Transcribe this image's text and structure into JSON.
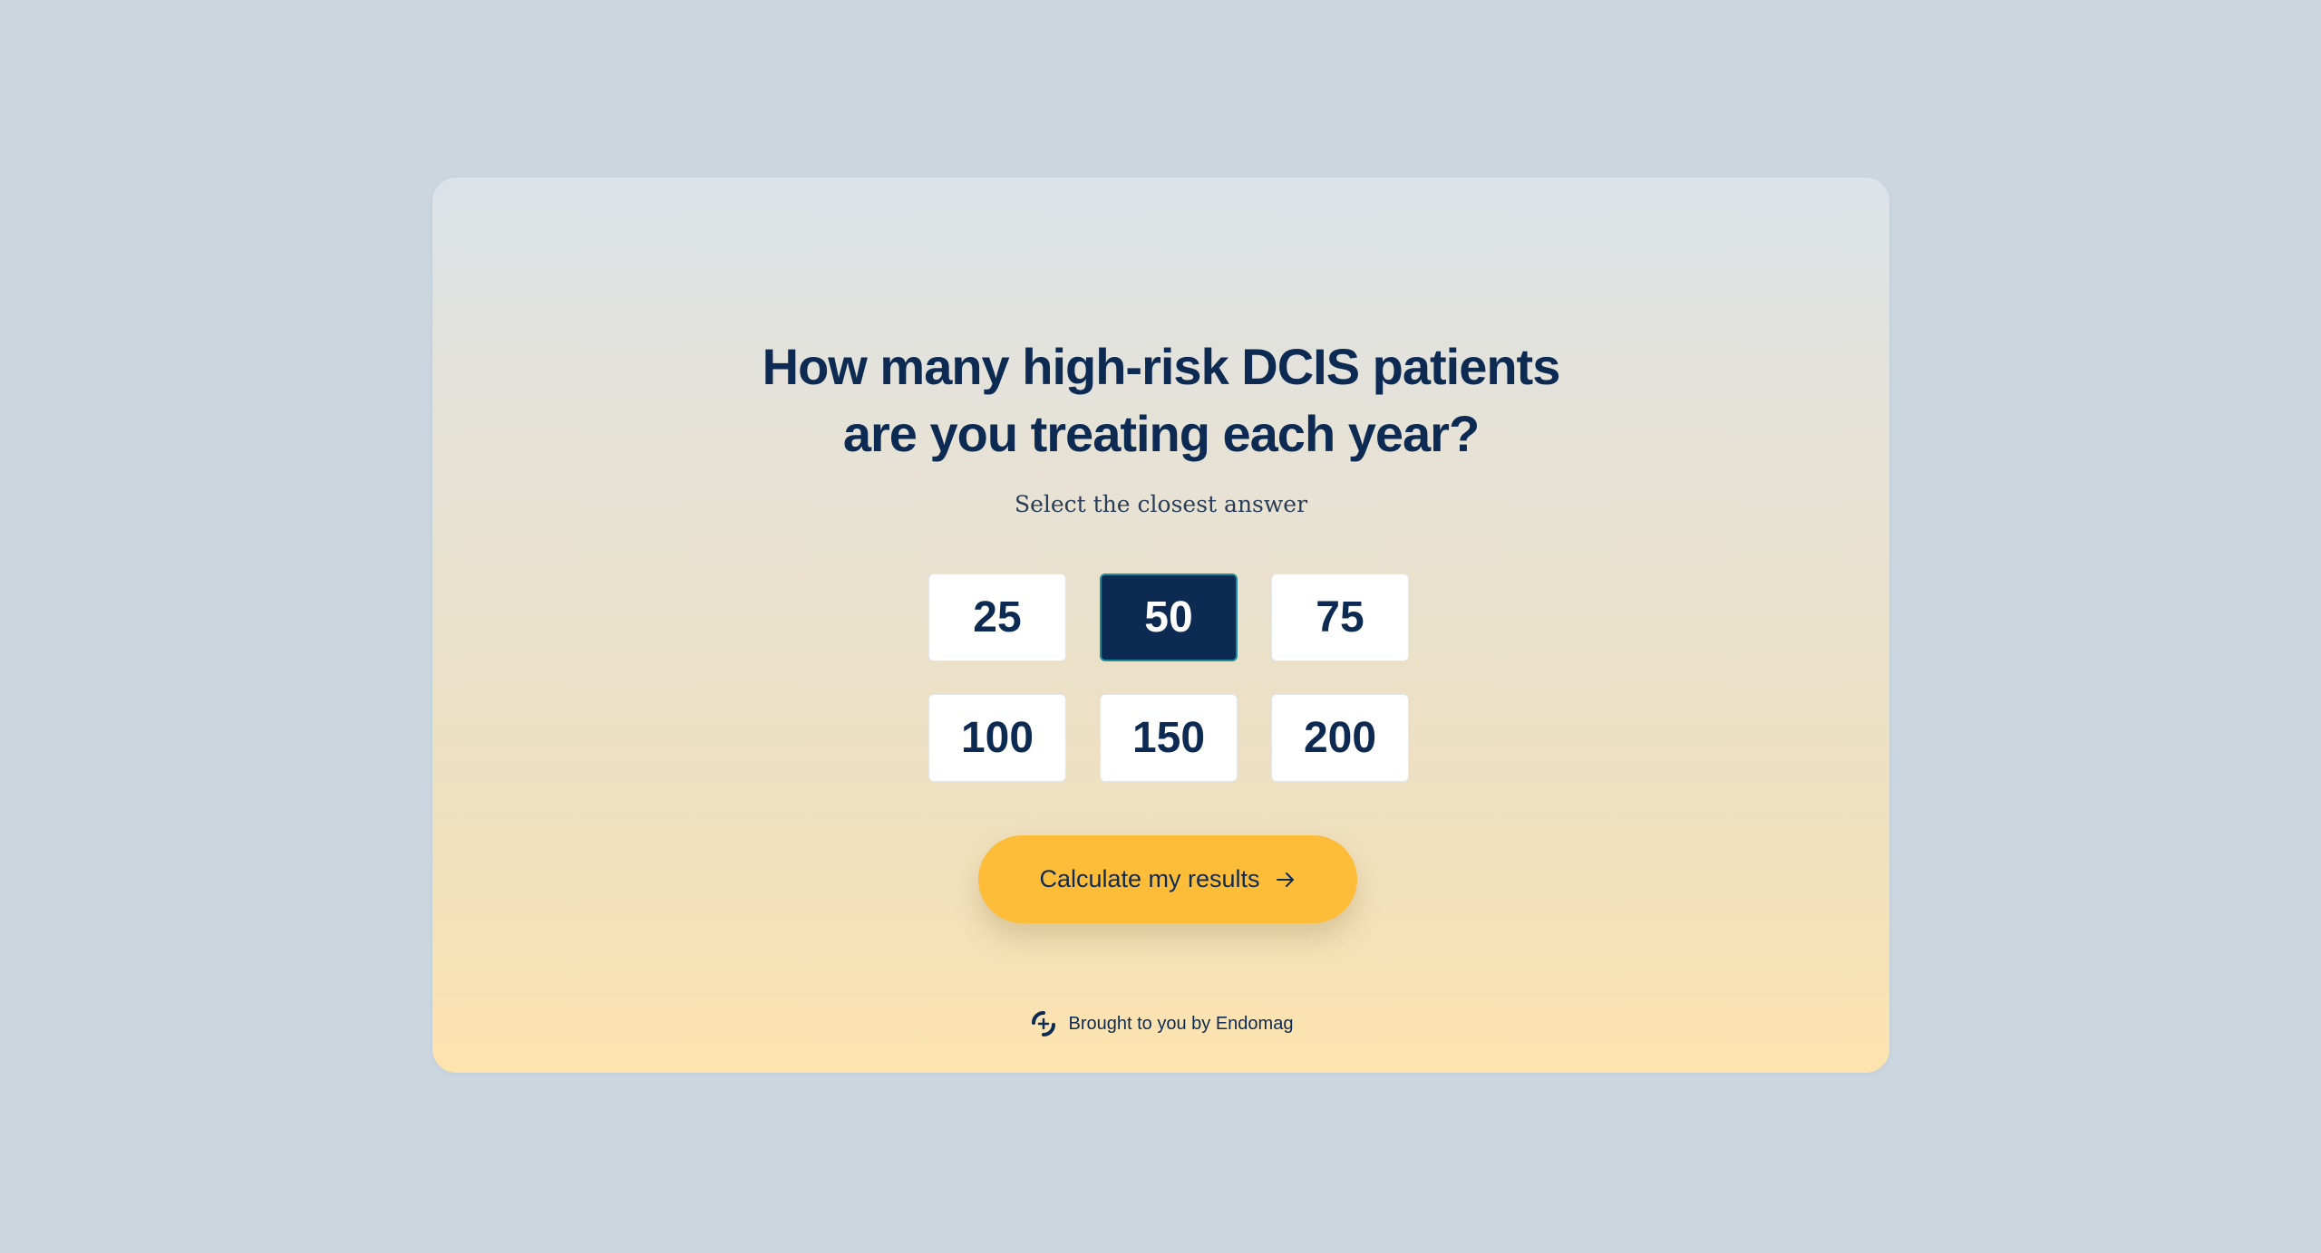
{
  "question": {
    "line1": "How many high-risk DCIS patients",
    "line2": "are you treating each year?"
  },
  "subtitle": "Select the closest answer",
  "options": [
    {
      "label": "25",
      "selected": false
    },
    {
      "label": "50",
      "selected": true
    },
    {
      "label": "75",
      "selected": false
    },
    {
      "label": "100",
      "selected": false
    },
    {
      "label": "150",
      "selected": false
    },
    {
      "label": "200",
      "selected": false
    }
  ],
  "cta": {
    "label": "Calculate my results",
    "icon": "arrow-right-icon"
  },
  "footer": {
    "text": "Brought to you by Endomag",
    "icon": "endomag-logo-icon"
  },
  "colors": {
    "page_background": "#cbd6df",
    "primary_navy": "#0d2a52",
    "accent_yellow": "#febd39",
    "selected_border": "#1e8c9c"
  }
}
